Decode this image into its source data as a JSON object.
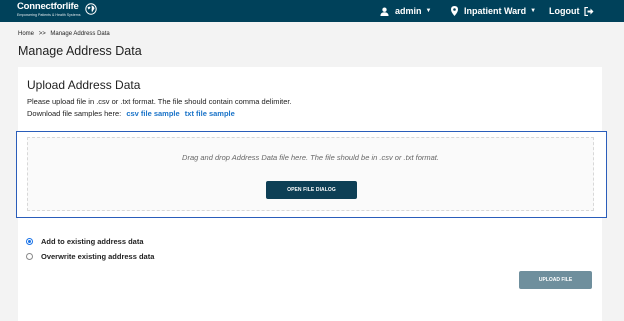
{
  "header": {
    "logo_main": "Connectforlife",
    "logo_tagline": "Empowering Patients & Health Systems",
    "user_label": "admin",
    "location_label": "Inpatient Ward",
    "logout_label": "Logout"
  },
  "breadcrumb": {
    "home": "Home",
    "separator": ">>",
    "current": "Manage Address Data"
  },
  "page_title": "Manage Address Data",
  "upload_section": {
    "title": "Upload Address Data",
    "instruction": "Please upload file in .csv or .txt format. The file should contain comma delimiter.",
    "samples_label": "Download file samples here:",
    "csv_sample_link": "csv file sample",
    "txt_sample_link": "txt file sample",
    "dropzone_text": "Drag and drop Address Data file here. The file should be in .csv or .txt format.",
    "open_dialog_button": "OPEN FILE DIALOG"
  },
  "options": {
    "add_label": "Add to existing address data",
    "overwrite_label": "Overwrite existing address data",
    "selected": "add"
  },
  "upload_button": "UPLOAD FILE",
  "colors": {
    "header_bg": "#00415a",
    "link": "#1a73c8",
    "primary_button": "#0d3f55",
    "disabled_button": "#6f8f9d",
    "focus_border": "#2a5dba"
  },
  "icons": {
    "logo": "globe-icon",
    "user": "user-icon",
    "location": "map-pin-icon",
    "logout": "logout-icon",
    "dropdown": "caret-down-icon"
  }
}
